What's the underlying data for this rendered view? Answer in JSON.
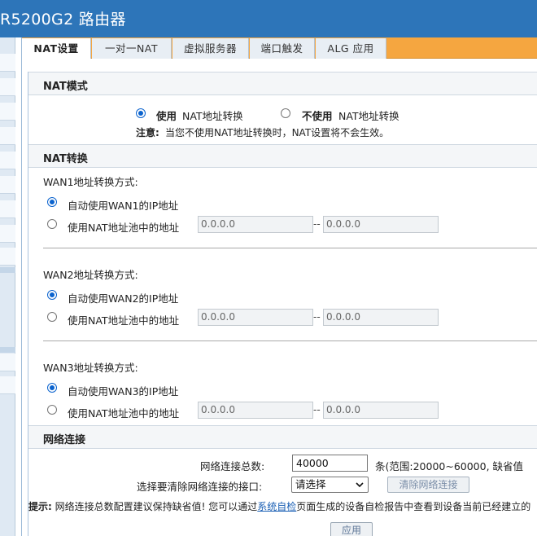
{
  "app_title": "R5200G2 路由器",
  "tabs": [
    {
      "label": "NAT设置",
      "active": true
    },
    {
      "label": "一对一NAT",
      "active": false
    },
    {
      "label": "虚拟服务器",
      "active": false
    },
    {
      "label": "端口触发",
      "active": false
    },
    {
      "label": "ALG 应用",
      "active": false
    }
  ],
  "nat_mode": {
    "heading": "NAT模式",
    "use_bold": "使用",
    "use_rest": "NAT地址转换",
    "nouse_bold": "不使用",
    "nouse_rest": "NAT地址转换",
    "selected": "use",
    "note_bold": "注意:",
    "note_text": "当您不使用NAT地址转换时，NAT设置将不会生效。"
  },
  "nat_translation": {
    "heading": "NAT转换",
    "wan": [
      {
        "label": "WAN1地址转换方式:",
        "auto_option": "自动使用WAN1的IP地址",
        "pool_option": "使用NAT地址池中的地址",
        "pool_start": "0.0.0.0",
        "pool_end": "0.0.0.0",
        "selected": "auto"
      },
      {
        "label": "WAN2地址转换方式:",
        "auto_option": "自动使用WAN2的IP地址",
        "pool_option": "使用NAT地址池中的地址",
        "pool_start": "0.0.0.0",
        "pool_end": "0.0.0.0",
        "selected": "auto"
      },
      {
        "label": "WAN3地址转换方式:",
        "auto_option": "自动使用WAN3的IP地址",
        "pool_option": "使用NAT地址池中的地址",
        "pool_start": "0.0.0.0",
        "pool_end": "0.0.0.0",
        "selected": "auto"
      }
    ],
    "range_dash": "--"
  },
  "network_conn": {
    "heading": "网络连接",
    "total_label": "网络连接总数:",
    "total_value": "40000",
    "range_hint": "条(范围:20000~60000, 缺省值",
    "clear_label": "选择要清除网络连接的接口:",
    "select_value": "请选择",
    "clear_button": "清除网络连接"
  },
  "tip": {
    "bold": "提示:",
    "before_link": "网络连接总数配置建议保持缺省值! 您可以通过",
    "link": "系统自检",
    "after_link": "页面生成的设备自检报告中查看到设备当前已经建立的"
  },
  "apply_button": "应用",
  "colors": {
    "topbar": "#2d75b9",
    "tab_strip": "#f5a640",
    "radio_selected": "#0b63ce"
  }
}
